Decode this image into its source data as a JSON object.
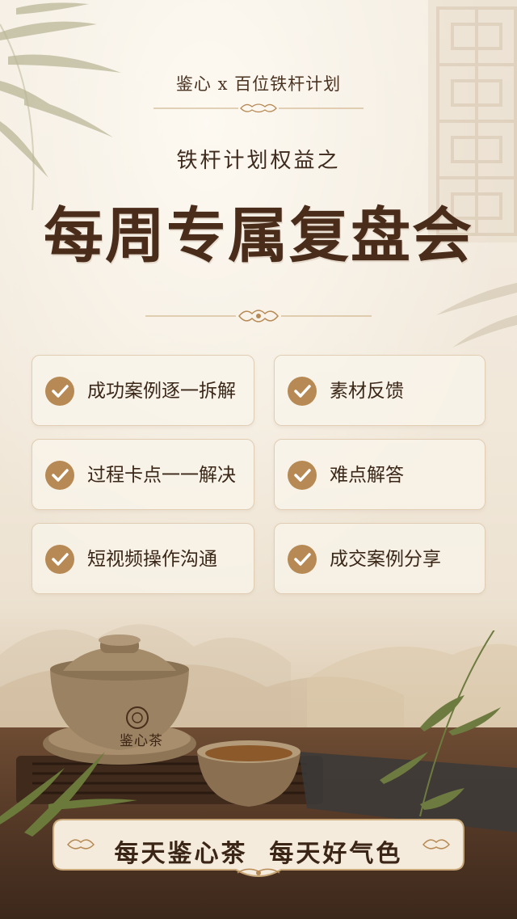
{
  "header": {
    "brand_line": "鉴心 x 百位铁杆计划",
    "subtitle": "铁杆计划权益之",
    "title": "每周专属复盘会"
  },
  "benefits": [
    {
      "label": "成功案例逐一拆解",
      "icon": "check-circle-icon"
    },
    {
      "label": "素材反馈",
      "icon": "check-circle-icon"
    },
    {
      "label": "过程卡点一一解决",
      "icon": "check-circle-icon"
    },
    {
      "label": "难点解答",
      "icon": "check-circle-icon"
    },
    {
      "label": "短视频操作沟通",
      "icon": "check-circle-icon"
    },
    {
      "label": "成交案例分享",
      "icon": "check-circle-icon"
    }
  ],
  "product": {
    "cup_logo_text": "鉴心茶"
  },
  "footer": {
    "slogan": "每天鉴心茶  每天好气色"
  },
  "colors": {
    "accent": "#b78a55",
    "title": "#4a2c1a",
    "background": "#f3ece1",
    "card_border": "#e0cdb4"
  }
}
